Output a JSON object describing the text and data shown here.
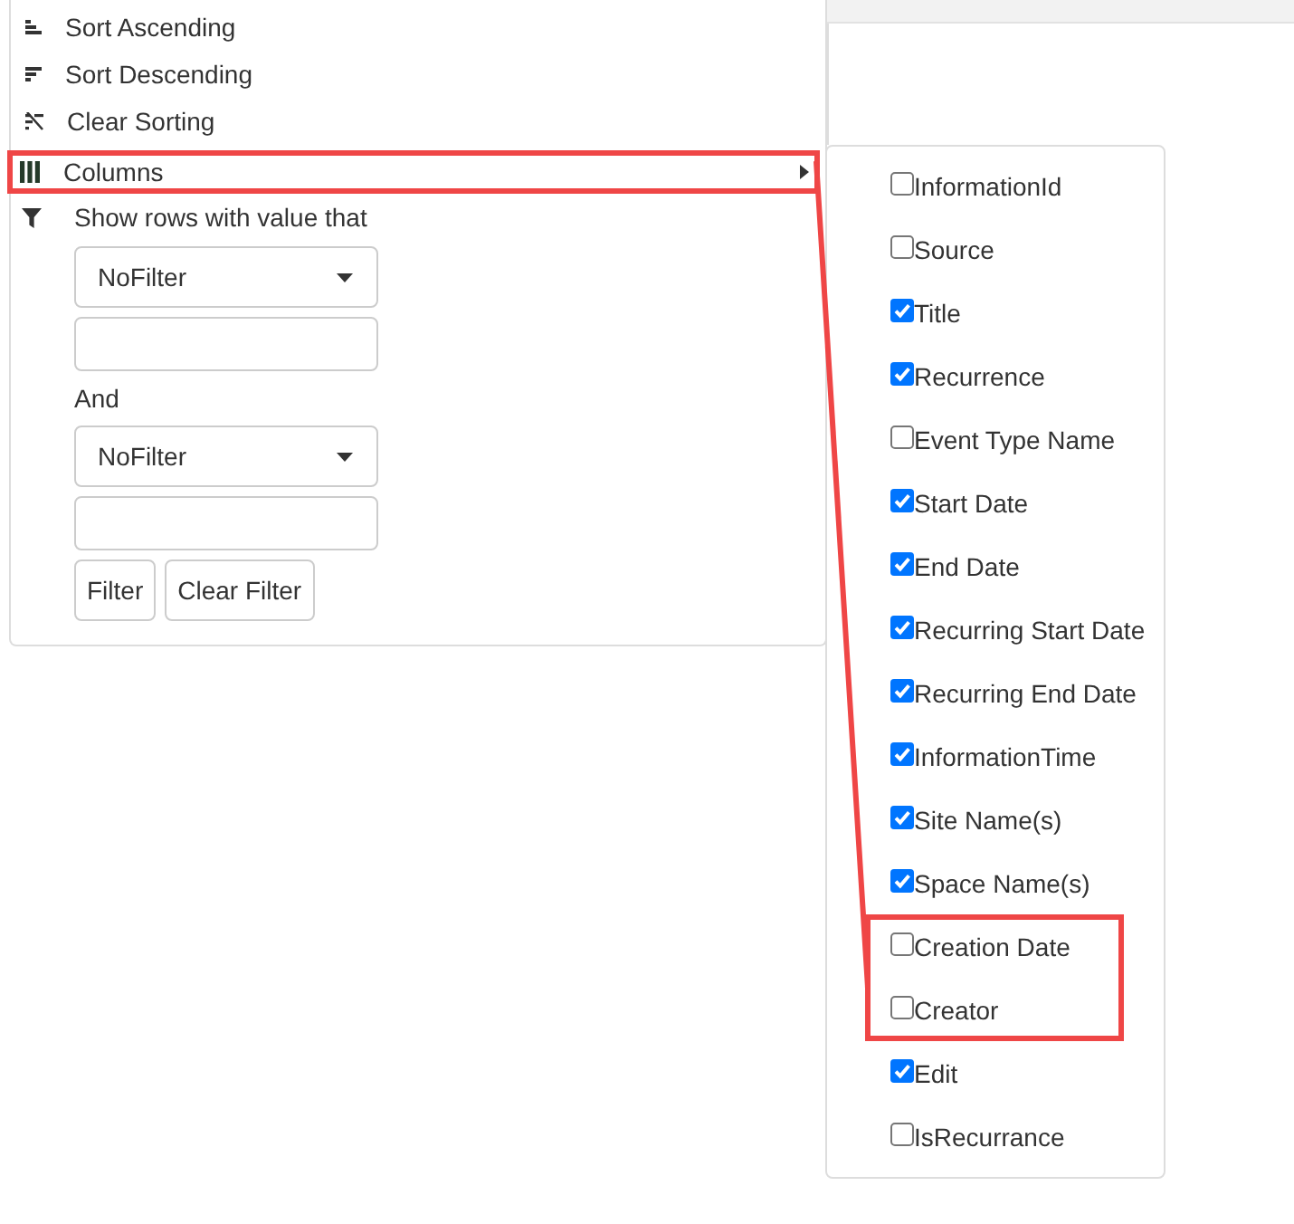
{
  "menu": {
    "items": [
      {
        "kind": "sort_ascending",
        "label": "Sort Ascending",
        "highlighted": false,
        "has_submenu": false
      },
      {
        "kind": "sort_descending",
        "label": "Sort Descending",
        "highlighted": false,
        "has_submenu": false
      },
      {
        "kind": "clear_sorting",
        "label": "Clear Sorting",
        "highlighted": false,
        "has_submenu": false
      },
      {
        "kind": "columns",
        "label": "Columns",
        "highlighted": true,
        "has_submenu": true
      }
    ]
  },
  "filter": {
    "heading": "Show rows with value that",
    "conditions": [
      {
        "operator": "NoFilter"
      },
      {
        "operator": "NoFilter"
      }
    ],
    "joiner": "And",
    "buttons": [
      "Filter",
      "Clear Filter"
    ]
  },
  "columns_menu": {
    "items": [
      {
        "label": "InformationId",
        "checked": false,
        "highlighted": false
      },
      {
        "label": "Source",
        "checked": false,
        "highlighted": false
      },
      {
        "label": "Title",
        "checked": true,
        "highlighted": false
      },
      {
        "label": "Recurrence",
        "checked": true,
        "highlighted": false
      },
      {
        "label": "Event Type Name",
        "checked": false,
        "highlighted": false
      },
      {
        "label": "Start Date",
        "checked": true,
        "highlighted": false
      },
      {
        "label": "End Date",
        "checked": true,
        "highlighted": false
      },
      {
        "label": "Recurring Start Date",
        "checked": true,
        "highlighted": false
      },
      {
        "label": "Recurring End Date",
        "checked": true,
        "highlighted": false
      },
      {
        "label": "InformationTime",
        "checked": true,
        "highlighted": false
      },
      {
        "label": "Site Name(s)",
        "checked": true,
        "highlighted": false
      },
      {
        "label": "Space Name(s)",
        "checked": true,
        "highlighted": false
      },
      {
        "label": "Creation Date",
        "checked": false,
        "highlighted": true
      },
      {
        "label": "Creator",
        "checked": false,
        "highlighted": true
      },
      {
        "label": "Edit",
        "checked": true,
        "highlighted": false
      },
      {
        "label": "IsRecurrance",
        "checked": false,
        "highlighted": false
      }
    ]
  }
}
